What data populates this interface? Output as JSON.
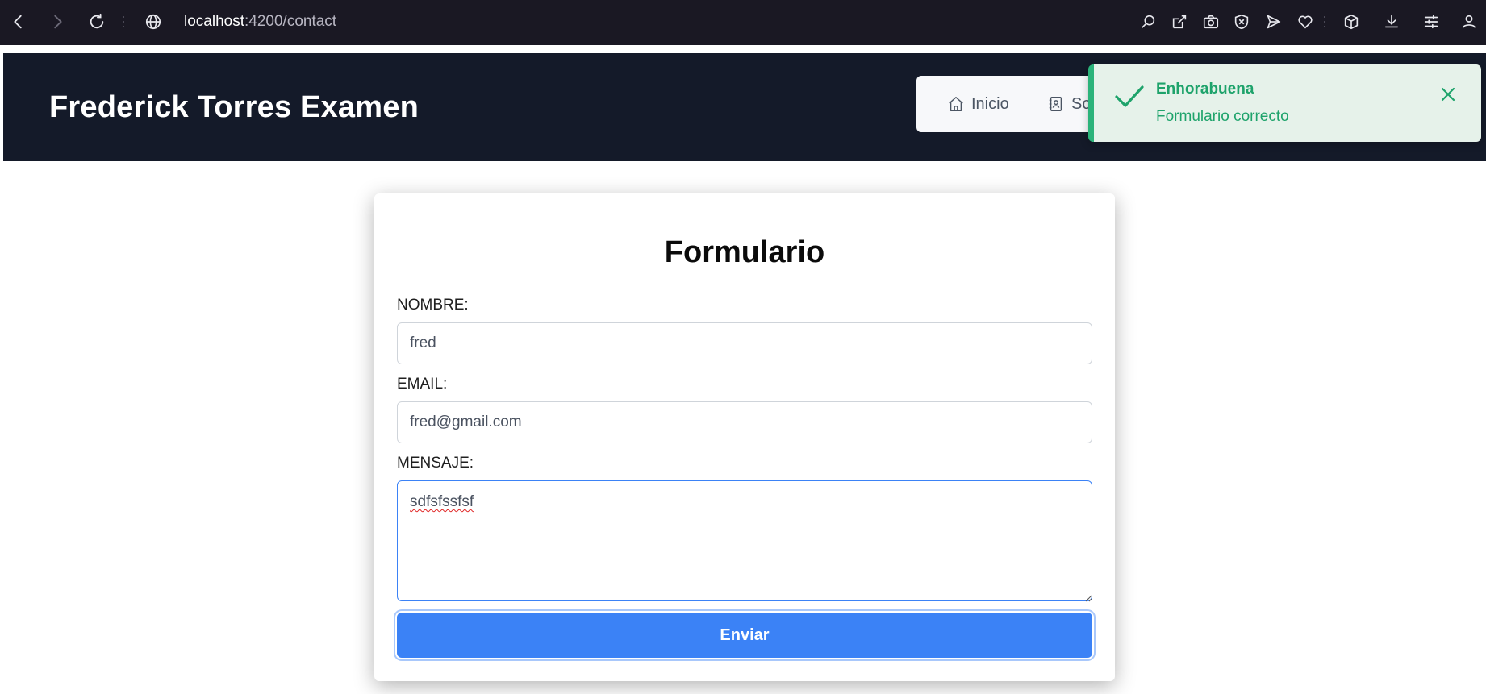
{
  "browser": {
    "url_host": "localhost",
    "url_path": ":4200/contact"
  },
  "header": {
    "title": "Frederick Torres Examen",
    "nav": [
      {
        "label": "Inicio",
        "icon": "home-icon"
      },
      {
        "label": "So",
        "icon": "contact-book-icon"
      }
    ]
  },
  "toast": {
    "summary": "Enhorabuena",
    "detail": "Formulario correcto",
    "color": "#1ea36b"
  },
  "form": {
    "title": "Formulario",
    "name_label": "NOMBRE:",
    "name_value": "fred",
    "email_label": "EMAIL:",
    "email_value": "fred@gmail.com",
    "message_label": "MENSAJE:",
    "message_value": "sdfsfssfsf",
    "submit_label": "Enviar"
  },
  "colors": {
    "header_bg": "#141a29",
    "accent": "#3b82f6",
    "success": "#2bb37a"
  }
}
